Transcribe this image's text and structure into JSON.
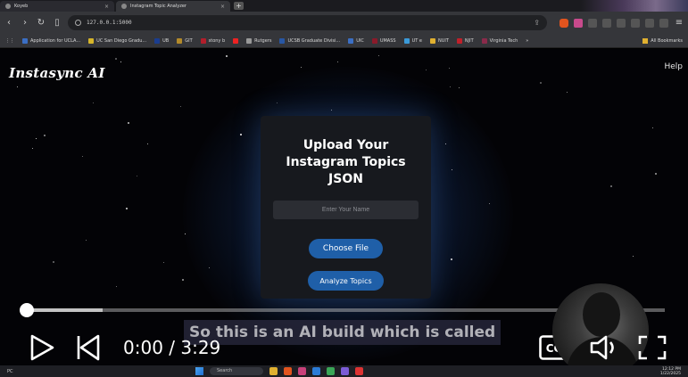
{
  "browser": {
    "tabs": [
      {
        "title": "Koyeb",
        "active": false
      },
      {
        "title": "Instagram Topic Analyzer",
        "active": true
      }
    ],
    "url": "127.0.0.1:5000",
    "bookmarks": [
      {
        "label": "Application for UCLA...",
        "color": "#3b6fc4"
      },
      {
        "label": "UC San Diego Gradu...",
        "color": "#d6b52a"
      },
      {
        "label": "UB",
        "color": "#1a3d8f"
      },
      {
        "label": "GIT",
        "color": "#b38a2a"
      },
      {
        "label": "stony b",
        "color": "#b21e2b"
      },
      {
        "label": "",
        "color": "#e22"
      },
      {
        "label": "Rutgers",
        "color": "#999"
      },
      {
        "label": "UCSB Graduate Divisi...",
        "color": "#2857a4"
      },
      {
        "label": "UIC",
        "color": "#3b6fc4"
      },
      {
        "label": "UMASS",
        "color": "#8a1a2a"
      },
      {
        "label": "UT e",
        "color": "#3b9ad9"
      },
      {
        "label": "NUIT",
        "color": "#e0b030"
      },
      {
        "label": "NJIT",
        "color": "#c0202a"
      },
      {
        "label": "Virginia Tech",
        "color": "#8a2a4a"
      }
    ],
    "bookmarks_overflow": "»",
    "all_bookmarks": "All Bookmarks"
  },
  "app": {
    "brand": "Instasync AI",
    "help": "Help",
    "card_title": "Upload Your Instagram Topics JSON",
    "name_placeholder": "Enter Your Name",
    "choose_file": "Choose File",
    "analyze": "Analyze Topics"
  },
  "player": {
    "caption": "So this is an AI build which is called",
    "time": "0:00 / 3:29",
    "progress_fraction": 0.0,
    "buffered_fraction": 0.12
  },
  "taskbar": {
    "weather": "PC",
    "search": "Search",
    "clock_time": "12:12 PM",
    "clock_date": "1/22/2025"
  },
  "colors": {
    "accent": "#1f5fa8",
    "page_bg": "#030306",
    "card_bg": "#17191e"
  }
}
